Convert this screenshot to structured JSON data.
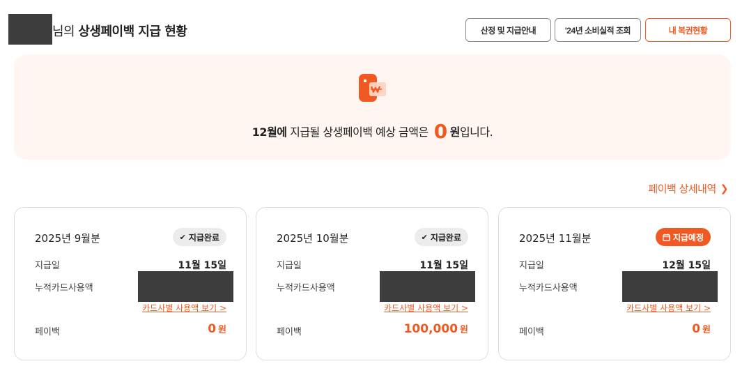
{
  "header": {
    "title_suffix_regular": "님의 ",
    "title_bold": "상생페이백 지급 현황",
    "buttons": {
      "guide": "산정 및 지급안내",
      "history": "'24년 소비실적 조회",
      "status": "내 복권현황"
    }
  },
  "banner": {
    "icon": "payment-card-icon",
    "month": "12월에",
    "text_middle": " 지급될 상생페이백 예상 금액은",
    "amount": "0",
    "unit": "원",
    "text_end": "입니다."
  },
  "detail_link": {
    "label": "페이백 상세내역",
    "icon": "chevron-right-icon"
  },
  "labels": {
    "pay_date": "지급일",
    "card_usage": "누적카드사용액",
    "card_breakdown_link": "카드사별 사용액 보기 >",
    "payback": "페이백",
    "won": "원"
  },
  "cards": [
    {
      "title": "2025년 9월분",
      "status": "지급완료",
      "status_icon": "check-icon",
      "pay_date": "11월 15일",
      "payback": "0"
    },
    {
      "title": "2025년 10월분",
      "status": "지급완료",
      "status_icon": "check-icon",
      "pay_date": "11월 15일",
      "payback": "100,000"
    },
    {
      "title": "2025년 11월분",
      "status": "지급예정",
      "status_icon": "calendar-icon",
      "pay_date": "12월 15일",
      "payback": "0"
    }
  ],
  "colors": {
    "accent": "#f05a22",
    "banner_bg": "#fff5f1",
    "redaction": "#3d3d3d"
  }
}
